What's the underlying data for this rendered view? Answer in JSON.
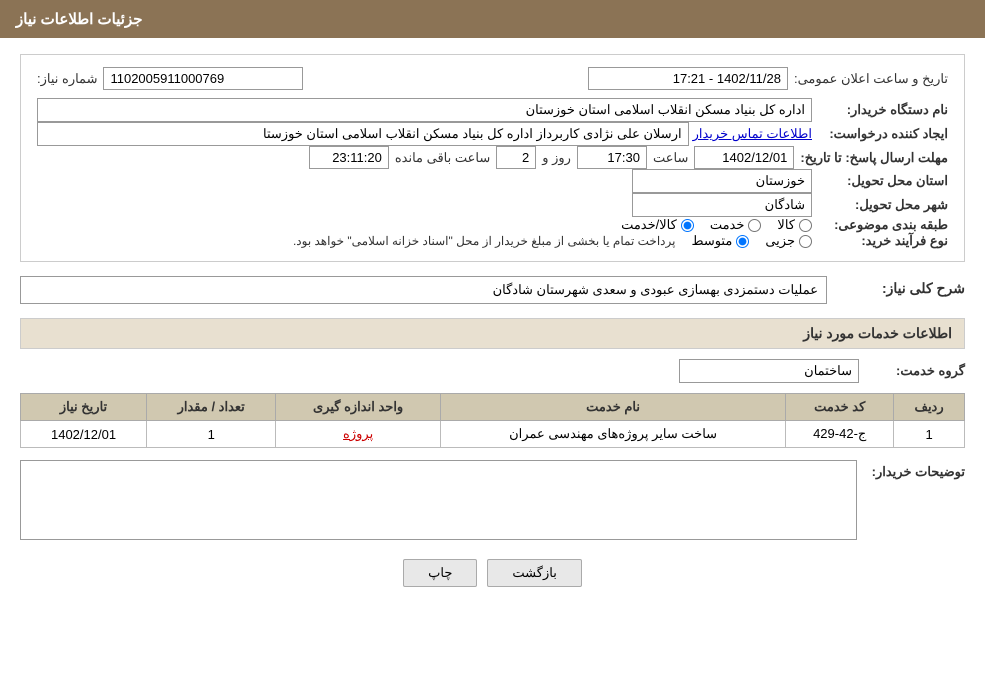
{
  "header": {
    "title": "جزئیات اطلاعات نیاز"
  },
  "need_info": {
    "need_number_label": "شماره نیاز:",
    "need_number_value": "1102005911000769",
    "announce_label": "تاریخ و ساعت اعلان عمومی:",
    "announce_value": "1402/11/28 - 17:21",
    "buyer_org_label": "نام دستگاه خریدار:",
    "buyer_org_value": "اداره کل بنیاد مسکن انقلاب اسلامی استان خوزستان",
    "creator_label": "ایجاد کننده درخواست:",
    "creator_value": "ارسلان علی نژادی کاربرداز اداره کل بنیاد مسکن انقلاب اسلامی استان خوزستا",
    "contact_link": "اطلاعات تماس خریدار",
    "reply_deadline_label": "مهلت ارسال پاسخ: تا تاریخ:",
    "reply_date": "1402/12/01",
    "reply_time_label": "ساعت",
    "reply_time": "17:30",
    "reply_day_label": "روز و",
    "reply_days": "2",
    "reply_remaining_label": "ساعت باقی مانده",
    "reply_remaining": "23:11:20",
    "province_label": "استان محل تحویل:",
    "province_value": "خوزستان",
    "city_label": "شهر محل تحویل:",
    "city_value": "شادگان",
    "category_label": "طبقه بندی موضوعی:",
    "category_options": [
      "کالا",
      "خدمت",
      "کالا/خدمت"
    ],
    "category_selected": "کالا/خدمت",
    "purchase_type_label": "نوع فرآیند خرید:",
    "purchase_options": [
      "جزیی",
      "متوسط"
    ],
    "purchase_note": "پرداخت تمام یا بخشی از مبلغ خریدار از محل \"اسناد خزانه اسلامی\" خواهد بود.",
    "purchase_selected": "متوسط"
  },
  "need_description": {
    "section_title": "شرح کلی نیاز:",
    "description_value": "عملیات دستمزدی بهسازی عبودی و سعدی شهرستان شادگان"
  },
  "services_info": {
    "section_title": "اطلاعات خدمات مورد نیاز",
    "service_group_label": "گروه خدمت:",
    "service_group_value": "ساختمان",
    "table_headers": [
      "ردیف",
      "کد خدمت",
      "نام خدمت",
      "واحد اندازه گیری",
      "تعداد / مقدار",
      "تاریخ نیاز"
    ],
    "table_rows": [
      {
        "row": "1",
        "code": "ج-42-429",
        "name": "ساخت سایر پروژه‌های مهندسی عمران",
        "unit": "پروژه",
        "quantity": "1",
        "date": "1402/12/01"
      }
    ]
  },
  "buyer_description": {
    "section_title": "توضیحات خریدار:",
    "description_value": ""
  },
  "buttons": {
    "print_label": "چاپ",
    "back_label": "بازگشت"
  }
}
